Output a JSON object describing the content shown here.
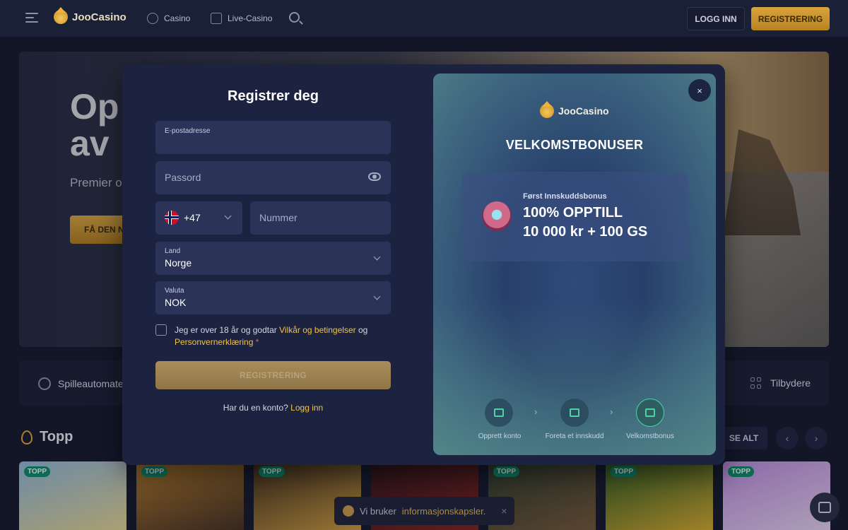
{
  "header": {
    "logo_text": "JooCasino",
    "nav": [
      {
        "label": "Casino",
        "icon": "spade-icon"
      },
      {
        "label": "Live-Casino",
        "icon": "dealer-icon"
      }
    ],
    "login_label": "LOGG INN",
    "register_label": "REGISTRERING"
  },
  "hero": {
    "title_line1": "Op",
    "title_line2": "av",
    "subtitle": "Premier op",
    "cta_label": "FÅ DEN N"
  },
  "categories": {
    "left_label": "Spilleautomater",
    "right_label": "Tilbydere"
  },
  "section": {
    "title": "Topp",
    "see_all_label": "SE ALT",
    "prev_label": "‹",
    "next_label": "›"
  },
  "games": [
    {
      "tag": "TOPP",
      "color_a": "#8fb6d6",
      "color_b": "#e6d38a"
    },
    {
      "tag": "TOPP",
      "color_a": "#b07a2a",
      "color_b": "#3b2a22"
    },
    {
      "tag": "TOPP",
      "color_a": "#3a2a1a",
      "color_b": "#d6a443"
    },
    {
      "tag": "",
      "color_a": "#2a1418",
      "color_b": "#8a2420"
    },
    {
      "tag": "TOPP",
      "color_a": "#2a3a2a",
      "color_b": "#7a5a3a"
    },
    {
      "tag": "TOPP",
      "color_a": "#2c5a20",
      "color_b": "#e0b030"
    },
    {
      "tag": "TOPP",
      "color_a": "#b88ad8",
      "color_b": "#e6d6f0"
    }
  ],
  "cookie": {
    "text": "Vi bruker",
    "link": "informasjonskapsler.",
    "close": "×"
  },
  "modal": {
    "title": "Registrer deg",
    "email_label": "E-postadresse",
    "password_placeholder": "Passord",
    "phone_code": "+47",
    "phone_placeholder": "Nummer",
    "country_label": "Land",
    "country_value": "Norge",
    "currency_label": "Valuta",
    "currency_value": "NOK",
    "terms_prefix": "Jeg er over 18 år og godtar",
    "terms_link": "Vilkår og betingelser",
    "terms_mid": "og",
    "privacy_link": "Personvernerklæring",
    "required_mark": "*",
    "submit_label": "REGISTRERING",
    "have_account": "Har du en konto?",
    "login_link": "Logg inn"
  },
  "panel": {
    "close": "×",
    "logo_text": "JooCasino",
    "title": "VELKOMSTBONUSER",
    "bonus_kicker": "Først Innskuddsbonus",
    "bonus_line1": "100% OPPTILL",
    "bonus_line2": "10 000 kr + 100 GS",
    "steps": [
      {
        "label": "Opprett konto",
        "icon": "enter-icon"
      },
      {
        "label": "Foreta et innskudd",
        "icon": "wallet-icon"
      },
      {
        "label": "Velkomstbonus",
        "icon": "gift-icon"
      }
    ],
    "step_arrow": "›"
  },
  "colors": {
    "accent": "#d8a43d",
    "link": "#f0c24b",
    "step_green": "#4fd3a3"
  }
}
